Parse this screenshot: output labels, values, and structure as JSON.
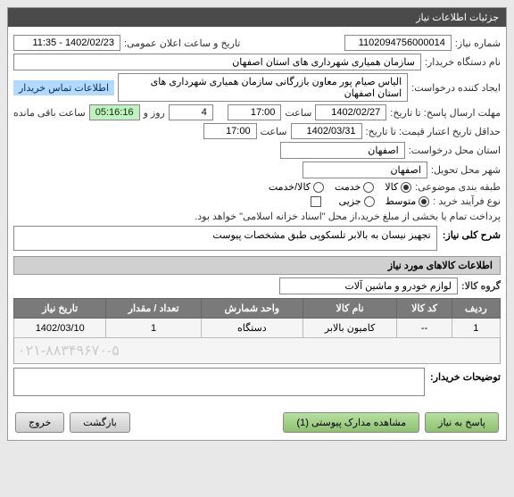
{
  "titlebar": "جزئیات اطلاعات نیاز",
  "labels": {
    "need_number": "شماره نیاز:",
    "public_announce_datetime": "تاریخ و ساعت اعلان عمومی:",
    "buyer_device_name": "نام دستگاه خریدار:",
    "request_creator": "ایجاد کننده درخواست:",
    "buyer_contact_info": "اطلاعات تماس خریدار",
    "response_deadline": "مهلت ارسال پاسخ: تا تاریخ:",
    "hour": "ساعت",
    "day_and": "روز و",
    "remaining_time": "ساعت باقی مانده",
    "price_validity_min": "حداقل تاریخ اعتبار قیمت: تا تاریخ:",
    "request_location": "استان محل درخواست:",
    "delivery_city": "شهر محل تحویل:",
    "subject_classification": "طبقه بندی موضوعی:",
    "goods": "کالا",
    "service": "خدمت",
    "goods_service": "کالا/خدمت",
    "purchase_process_type": "نوع فرآیند خرید :",
    "medium": "متوسط",
    "partial": "جزیی",
    "payment_note": "پرداخت تمام یا بخشی از مبلغ خرید،از محل \"اسناد خزانه اسلامی\" خواهد بود.",
    "general_desc": "شرح کلی نیاز:",
    "goods_info_section": "اطلاعات کالاهای مورد نیاز",
    "goods_group": "گروه کالا:",
    "buyer_notes": "توضیحات خریدار:"
  },
  "values": {
    "need_number": "1102094756000014",
    "public_announce_datetime": "1402/02/23 - 11:35",
    "buyer_device_name": "سازمان همیاری شهرداری های استان اصفهان",
    "request_creator": "الیاس صیام پور معاون بازرگانی  سازمان همیاری شهرداری های استان اصفهان",
    "response_deadline_date": "1402/02/27",
    "response_deadline_time": "17:00",
    "days_remaining": "4",
    "time_remaining": "05:16:16",
    "price_validity_date": "1402/03/31",
    "price_validity_time": "17:00",
    "request_location": "اصفهان",
    "delivery_city": "اصفهان",
    "general_desc": "تجهیز نیسان به بالابر تلسکوپی طبق مشخصات پیوست",
    "goods_group": "لوازم خودرو و ماشین آلات",
    "buyer_phone": "۰۲۱-۸۸۳۴۹۶۷۰-۵"
  },
  "table": {
    "headers": {
      "row": "ردیف",
      "code": "کد کالا",
      "name": "نام کالا",
      "unit": "واحد شمارش",
      "qty": "تعداد / مقدار",
      "need_date": "تاریخ نیاز"
    },
    "rows": [
      {
        "row": "1",
        "code": "--",
        "name": "کامیون بالابر",
        "unit": "دستگاه",
        "qty": "1",
        "need_date": "1402/03/10"
      }
    ]
  },
  "buttons": {
    "respond": "پاسخ به نیاز",
    "view_attachments": "مشاهده مدارک پیوستی (1)",
    "back": "بازگشت",
    "exit": "خروج"
  }
}
